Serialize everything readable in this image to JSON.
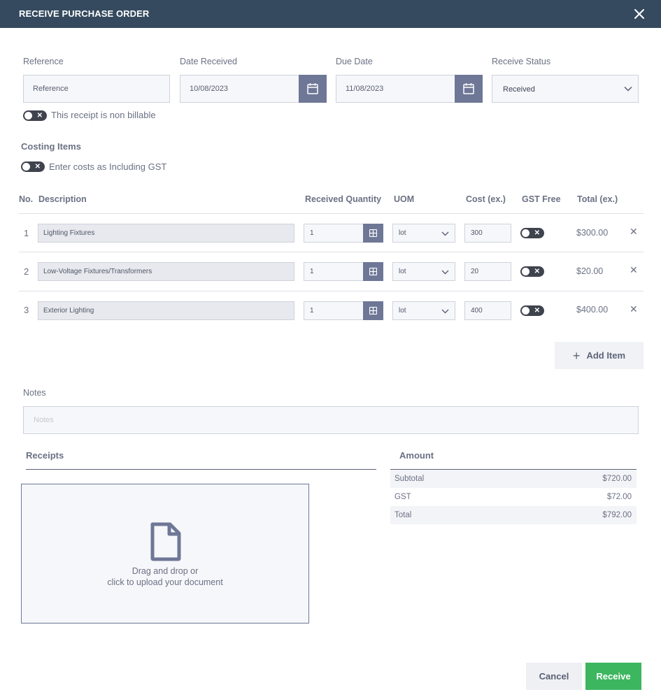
{
  "header": {
    "title": "RECEIVE PURCHASE ORDER",
    "close_icon": "close-icon"
  },
  "form": {
    "reference": {
      "label": "Reference",
      "value": "Reference"
    },
    "date_received": {
      "label": "Date Received",
      "value": "10/08/2023",
      "icon": "calendar-icon"
    },
    "due_date": {
      "label": "Due Date",
      "value": "11/08/2023",
      "icon": "calendar-icon"
    },
    "receive_status": {
      "label": "Receive Status",
      "value": "Received"
    },
    "non_billable": {
      "label": "This receipt is non billable",
      "on": false
    }
  },
  "costing": {
    "title": "Costing Items",
    "including_gst": {
      "label": "Enter costs as Including GST",
      "on": false
    },
    "columns": [
      "No.",
      "Description",
      "Received Quantity",
      "UOM",
      "Cost (ex.)",
      "GST Free",
      "Total (ex.)"
    ],
    "rows": [
      {
        "no": "1",
        "description": "Lighting Fixtures",
        "quantity": "1",
        "uom": "lot",
        "cost": "300",
        "gst_free": false,
        "total": "$300.00"
      },
      {
        "no": "2",
        "description": "Low-Voltage Fixtures/Transformers",
        "quantity": "1",
        "uom": "lot",
        "cost": "20",
        "gst_free": false,
        "total": "$20.00"
      },
      {
        "no": "3",
        "description": "Exterior Lighting",
        "quantity": "1",
        "uom": "lot",
        "cost": "400",
        "gst_free": false,
        "total": "$400.00"
      }
    ],
    "add_item_label": "Add Item"
  },
  "notes": {
    "label": "Notes",
    "placeholder": "Notes"
  },
  "receipts": {
    "title": "Receipts",
    "drop_line1": "Drag and drop or",
    "drop_line2": "click to upload your document",
    "icon": "document-icon"
  },
  "amount": {
    "title": "Amount",
    "rows": [
      {
        "label": "Subtotal",
        "value": "$720.00"
      },
      {
        "label": "GST",
        "value": "$72.00"
      },
      {
        "label": "Total",
        "value": "$792.00"
      }
    ]
  },
  "footer": {
    "cancel_label": "Cancel",
    "receive_label": "Receive"
  },
  "colors": {
    "header": "#354a5f",
    "accent_button": "#6e7796",
    "receive_button": "#3db660"
  }
}
